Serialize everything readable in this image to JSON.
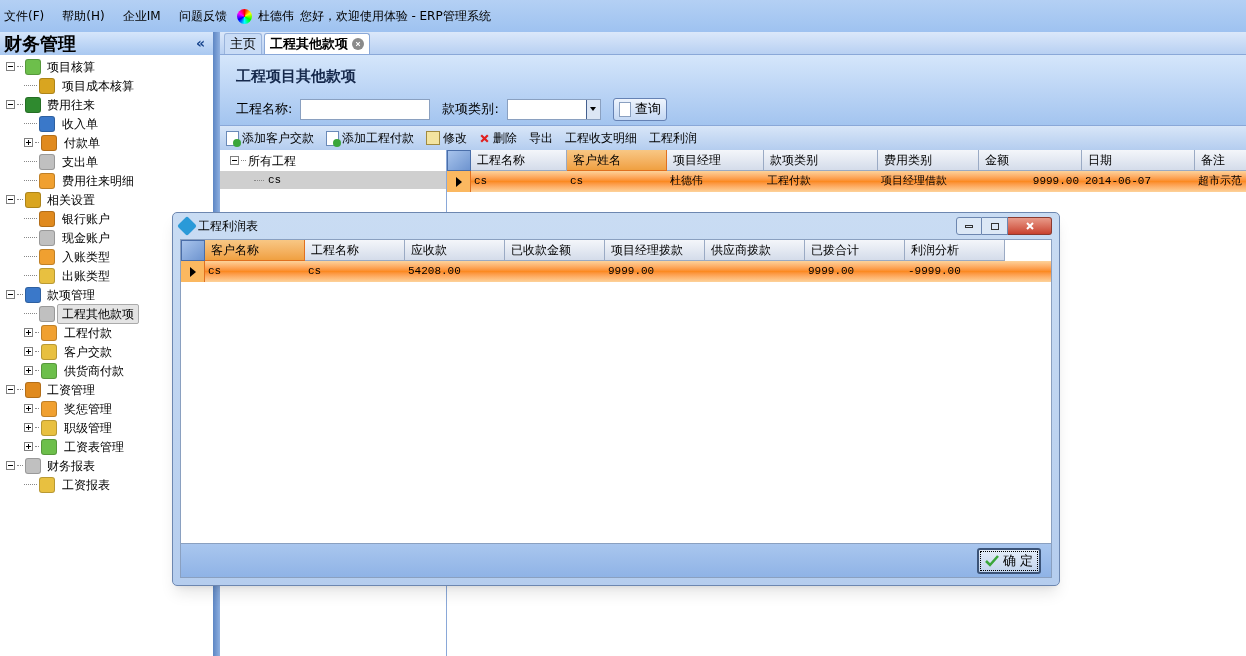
{
  "menu_bar": {
    "items": [
      "文件(F)",
      "帮助(H)",
      "企业IM",
      "问题反馈"
    ],
    "user": "杜德伟",
    "greeting": "您好，欢迎使用体验 - ERP管理系统"
  },
  "sidebar": {
    "title": "财务管理",
    "collapse": "«",
    "tree": [
      {
        "label": "项目核算",
        "expanded": true,
        "selected": false,
        "children": [
          {
            "label": "项目成本核算",
            "selected": false
          }
        ]
      },
      {
        "label": "费用往来",
        "expanded": true,
        "selected": false,
        "children": [
          {
            "label": "收入单",
            "selected": false
          },
          {
            "label": "付款单",
            "expanded": false,
            "selected": false
          },
          {
            "label": "支出单",
            "selected": false
          },
          {
            "label": "费用往来明细",
            "selected": false
          }
        ]
      },
      {
        "label": "相关设置",
        "expanded": true,
        "selected": false,
        "children": [
          {
            "label": "银行账户",
            "selected": false
          },
          {
            "label": "现金账户",
            "selected": false
          },
          {
            "label": "入账类型",
            "selected": false
          },
          {
            "label": "出账类型",
            "selected": false
          }
        ]
      },
      {
        "label": "款项管理",
        "expanded": true,
        "selected": false,
        "children": [
          {
            "label": "工程其他款项",
            "selected": true
          },
          {
            "label": "工程付款",
            "expanded": false,
            "selected": false
          },
          {
            "label": "客户交款",
            "expanded": false,
            "selected": false
          },
          {
            "label": "供货商付款",
            "expanded": false,
            "selected": false
          }
        ]
      },
      {
        "label": "工资管理",
        "expanded": true,
        "selected": false,
        "children": [
          {
            "label": "奖惩管理",
            "expanded": false,
            "selected": false
          },
          {
            "label": "职级管理",
            "expanded": false,
            "selected": false
          },
          {
            "label": "工资表管理",
            "expanded": false,
            "selected": false
          }
        ]
      },
      {
        "label": "财务报表",
        "expanded": true,
        "selected": false,
        "children": [
          {
            "label": "工资报表",
            "selected": false
          }
        ]
      }
    ]
  },
  "tabs": [
    {
      "label": "主页",
      "selected": false
    },
    {
      "label": "工程其他款项",
      "selected": true
    }
  ],
  "page": {
    "title": "工程项目其他款项",
    "search": [
      {
        "kind": "text",
        "label": "工程名称:"
      },
      {
        "kind": "select",
        "label": "款项类别:"
      }
    ],
    "search_button": "查询",
    "toolbar": [
      {
        "kind": "add",
        "label": "添加客户交款"
      },
      {
        "kind": "add",
        "label": "添加工程付款"
      },
      {
        "kind": "edit",
        "label": "修改"
      },
      {
        "kind": "delete",
        "label": "删除"
      },
      {
        "kind": "plain",
        "label": "导出"
      },
      {
        "kind": "plain",
        "label": "工程收支明细"
      },
      {
        "kind": "plain",
        "label": "工程利润"
      }
    ],
    "project_tree": {
      "label": "所有工程",
      "expanded": true,
      "children": [
        {
          "label": "cs",
          "selected": true
        }
      ]
    },
    "table": {
      "columns": [
        {
          "label": "工程名称",
          "selected": false,
          "kind": "text"
        },
        {
          "label": "客户姓名",
          "selected": true,
          "kind": "text"
        },
        {
          "label": "项目经理",
          "selected": false,
          "kind": "text"
        },
        {
          "label": "款项类别",
          "selected": false,
          "kind": "text"
        },
        {
          "label": "费用类别",
          "selected": false,
          "kind": "text"
        },
        {
          "label": "金额",
          "selected": false,
          "kind": "amount"
        },
        {
          "label": "日期",
          "selected": false,
          "kind": "text"
        },
        {
          "label": "备注",
          "selected": false,
          "kind": "text"
        }
      ],
      "rows": [
        {
          "selected": true,
          "cells": [
            "cs",
            "cs",
            "杜德伟",
            "工程付款",
            "项目经理借款",
            "9999.00",
            "2014-06-07",
            "超市示范"
          ]
        }
      ]
    }
  },
  "dialog": {
    "title": "工程利润表",
    "table": {
      "columns": [
        {
          "label": "客户名称",
          "selected": true
        },
        {
          "label": "工程名称",
          "selected": false
        },
        {
          "label": "应收款",
          "selected": false
        },
        {
          "label": "已收款金额",
          "selected": false
        },
        {
          "label": "项目经理拨款",
          "selected": false
        },
        {
          "label": "供应商拨款",
          "selected": false
        },
        {
          "label": "已拨合计",
          "selected": false
        },
        {
          "label": "利润分析",
          "selected": false
        }
      ],
      "rows": [
        {
          "selected": true,
          "cells": [
            "cs",
            "cs",
            "54208.00",
            "",
            "9999.00",
            "",
            "9999.00",
            "-9999.00"
          ]
        }
      ]
    },
    "ok_button": "确 定"
  }
}
